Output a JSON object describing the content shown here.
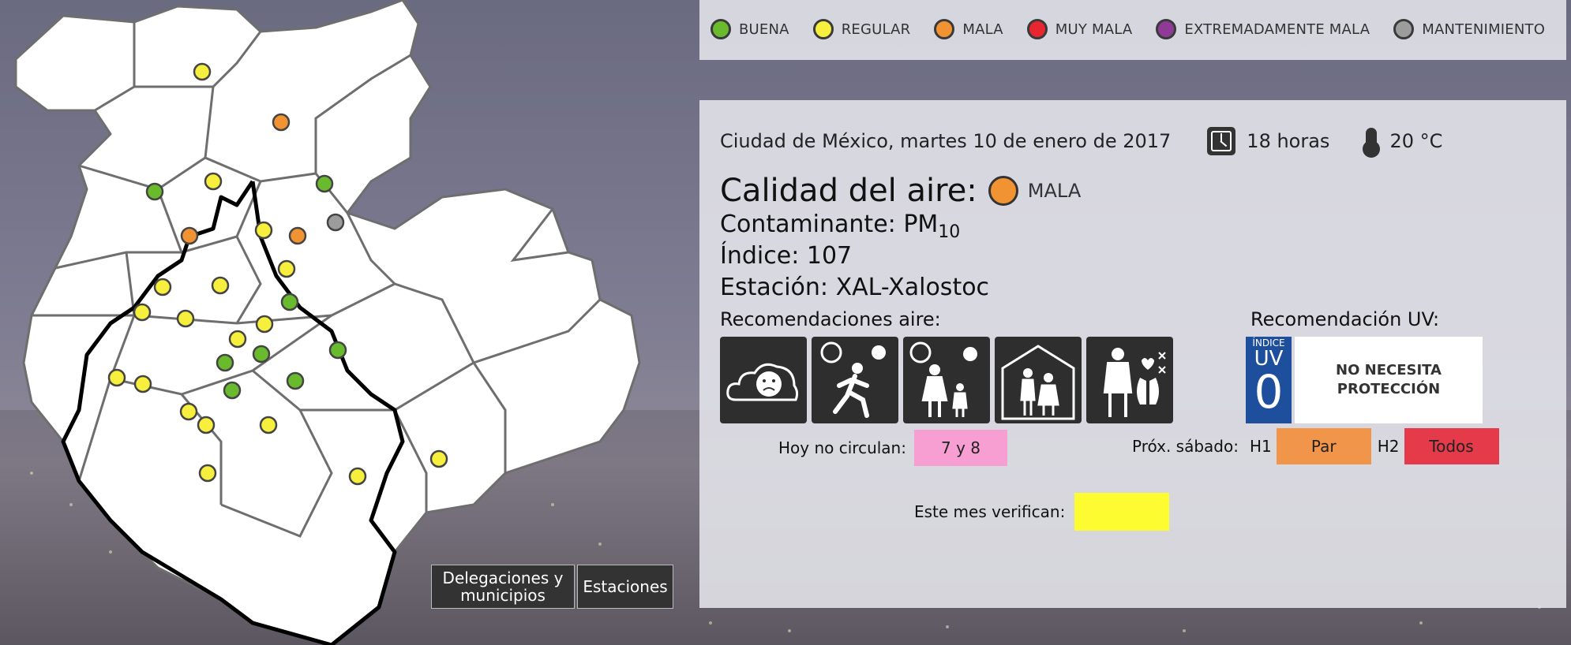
{
  "legend": [
    {
      "label": "BUENA",
      "color": "#6aba2e"
    },
    {
      "label": "REGULAR",
      "color": "#f6ef3d"
    },
    {
      "label": "MALA",
      "color": "#f19233"
    },
    {
      "label": "MUY MALA",
      "color": "#e8262f"
    },
    {
      "label": "EXTREMADAMENTE MALA",
      "color": "#8e3a96"
    },
    {
      "label": "MANTENIMIENTO",
      "color": "#9c9c9c"
    }
  ],
  "report": {
    "location_date": "Ciudad de México, martes 10 de enero de 2017",
    "hour": "18 horas",
    "temperature": "20 °C",
    "quality_title": "Calidad del aire:",
    "quality_label": "MALA",
    "quality_color": "#f19233",
    "pollutant_label": "Contaminante:",
    "pollutant_value": "PM",
    "pollutant_sub": "10",
    "index_label": "Índice:",
    "index_value": "107",
    "station_label": "Estación:",
    "station_value": "XAL-Xalostoc",
    "recs_air_title": "Recomendaciones aire:",
    "recs_uv_title": "Recomendación UV:",
    "rec_icons": [
      "cloud-sad-icon",
      "running-sun-icon",
      "mother-child-sun-icon",
      "elderly-shelter-icon",
      "lungs-heart-icon"
    ],
    "uv_small": "ÍNDICE",
    "uv_text": "UV",
    "uv_value": "0",
    "uv_message_1": "NO NECESITA",
    "uv_message_2": "PROTECCIÓN",
    "hoy_no_circulan_label": "Hoy no circulan:",
    "hoy_no_circulan_value": "7 y 8",
    "prox_sabado_label": "Próx. sábado:",
    "h1_label": "H1",
    "h1_value": "Par",
    "h2_label": "H2",
    "h2_value": "Todos",
    "verifican_label": "Este mes verifican:"
  },
  "map_buttons": {
    "delegaciones": "Delegaciones y municipios",
    "estaciones": "Estaciones"
  },
  "stations": [
    {
      "status": "REGULAR"
    },
    {
      "status": "MALA"
    },
    {
      "status": "REGULAR"
    },
    {
      "status": "BUENA"
    },
    {
      "status": "BUENA"
    },
    {
      "status": "MANTENIMIENTO"
    },
    {
      "status": "MALA"
    },
    {
      "status": "REGULAR"
    },
    {
      "status": "MALA"
    },
    {
      "status": "REGULAR"
    },
    {
      "status": "REGULAR"
    },
    {
      "status": "REGULAR"
    },
    {
      "status": "BUENA"
    },
    {
      "status": "REGULAR"
    },
    {
      "status": "REGULAR"
    },
    {
      "status": "REGULAR"
    },
    {
      "status": "BUENA"
    },
    {
      "status": "BUENA"
    },
    {
      "status": "REGULAR"
    },
    {
      "status": "REGULAR"
    },
    {
      "status": "BUENA"
    },
    {
      "status": "BUENA"
    },
    {
      "status": "BUENA"
    },
    {
      "status": "REGULAR"
    },
    {
      "status": "REGULAR"
    },
    {
      "status": "REGULAR"
    },
    {
      "status": "REGULAR"
    },
    {
      "status": "REGULAR"
    },
    {
      "status": "REGULAR"
    },
    {
      "status": "REGULAR"
    }
  ]
}
